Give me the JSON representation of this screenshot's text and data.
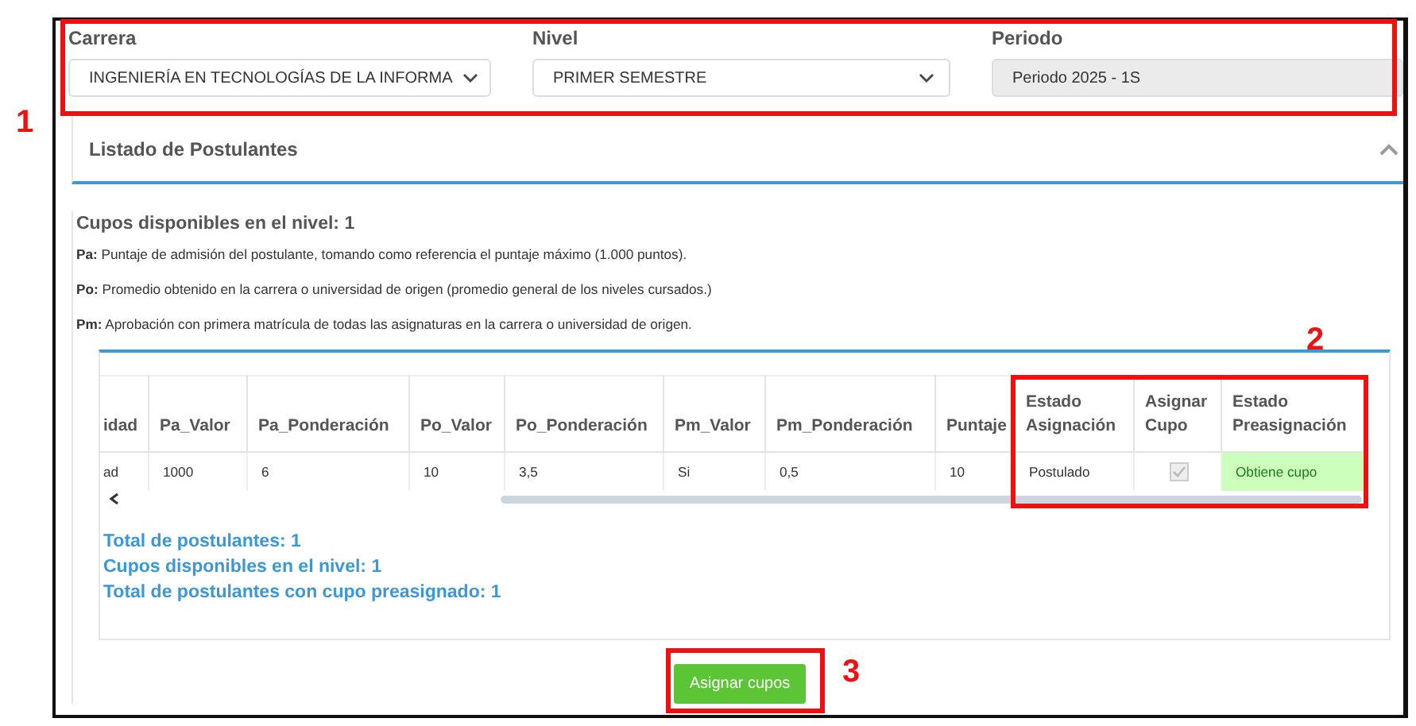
{
  "filters": [
    {
      "label": "Carrera",
      "value": "INGENIERÍA EN TECNOLOGÍAS DE LA INFORMA",
      "disabled": false
    },
    {
      "label": "Nivel",
      "value": "PRIMER SEMESTRE",
      "disabled": false
    },
    {
      "label": "Periodo",
      "value": "Periodo 2025 - 1S",
      "disabled": true
    }
  ],
  "panel": {
    "title": "Listado de Postulantes",
    "expanded": true
  },
  "available_heading": "Cupos disponibles en el nivel: 1",
  "definitions": [
    "**Pa:** Puntaje de admisión del postulante, tomando como referencia el puntaje máximo (1.000 puntos).",
    "**Po:** Promedio obtenido en la carrera o universidad de origen (promedio general de los niveles cursados.)",
    "**Pm:** Aprobación con primera matrícula de todas las asignaturas en la carrera o universidad de origen."
  ],
  "table": {
    "columns": [
      "idad",
      "Pa_Valor",
      "Pa_Ponderación",
      "Po_Valor",
      "Po_Ponderación",
      "Pm_Valor",
      "Pm_Ponderación",
      "Puntaje",
      "Estado Asignación",
      "Asignar Cupo",
      "Estado Preasignación"
    ],
    "rows": [
      {
        "cells": [
          {
            "kind": "text",
            "text": "ad"
          },
          {
            "kind": "text",
            "text": "1000"
          },
          {
            "kind": "text",
            "text": "6"
          },
          {
            "kind": "text",
            "text": "10"
          },
          {
            "kind": "text",
            "text": "3,5"
          },
          {
            "kind": "text",
            "text": "Si"
          },
          {
            "kind": "text",
            "text": "0,5"
          },
          {
            "kind": "text",
            "text": "10"
          },
          {
            "kind": "text",
            "text": "Postulado"
          },
          {
            "kind": "checkbox",
            "checked": true,
            "disabled": true
          },
          {
            "kind": "status",
            "text": "Obtiene cupo",
            "success": true
          }
        ]
      }
    ]
  },
  "totals": [
    "Total de postulantes: 1",
    "Cupos disponibles en el nivel: 1",
    "Total de postulantes con cupo preasignado: 1"
  ],
  "assign_button": "Asignar cupos",
  "annotations": [
    {
      "label": "1"
    },
    {
      "label": "2"
    },
    {
      "label": "3"
    }
  ]
}
